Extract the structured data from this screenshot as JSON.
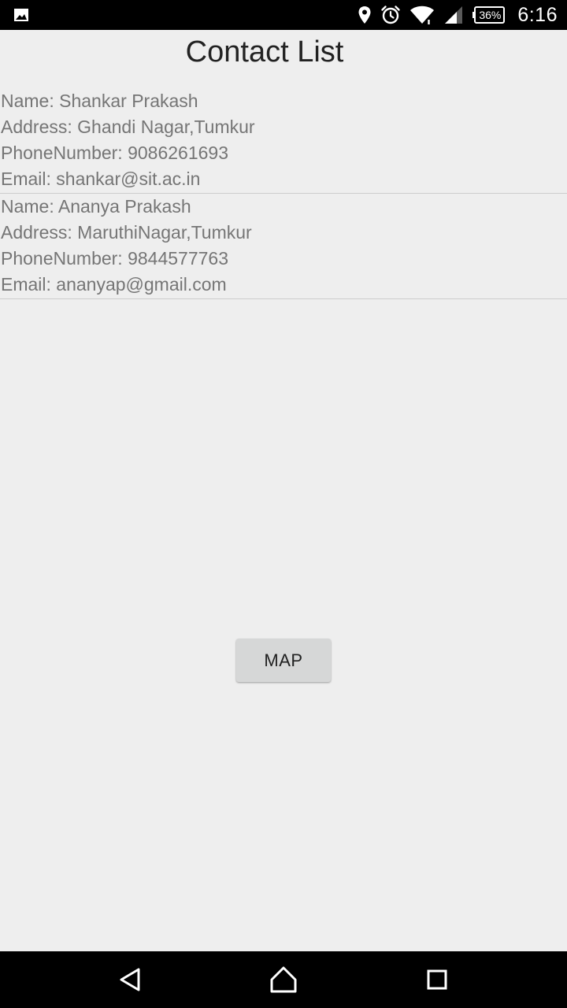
{
  "status_bar": {
    "notification_icon": "image-icon",
    "location_icon": "location-pin-icon",
    "alarm_icon": "alarm-clock-icon",
    "wifi_icon": "wifi-icon",
    "signal_icon": "cell-signal-icon",
    "battery_percent": "36%",
    "time": "6:16"
  },
  "page": {
    "title": "Contact List"
  },
  "contacts": [
    {
      "name": "Name: Shankar Prakash",
      "address": "Address: Ghandi Nagar,Tumkur",
      "phone": "PhoneNumber: 9086261693",
      "email": "Email: shankar@sit.ac.in"
    },
    {
      "name": "Name: Ananya Prakash",
      "address": "Address: MaruthiNagar,Tumkur",
      "phone": "PhoneNumber: 9844577763",
      "email": "Email: ananyap@gmail.com"
    }
  ],
  "actions": {
    "map_label": "MAP"
  },
  "nav_bar": {
    "back_icon": "back-triangle-icon",
    "home_icon": "home-icon",
    "recents_icon": "recents-square-icon"
  },
  "colors": {
    "background": "#eeeeee",
    "bars": "#000000",
    "title_text": "#222222",
    "body_text": "#757575",
    "divider": "#cccccc",
    "button_bg": "#d6d7d7",
    "button_text": "#212121"
  }
}
